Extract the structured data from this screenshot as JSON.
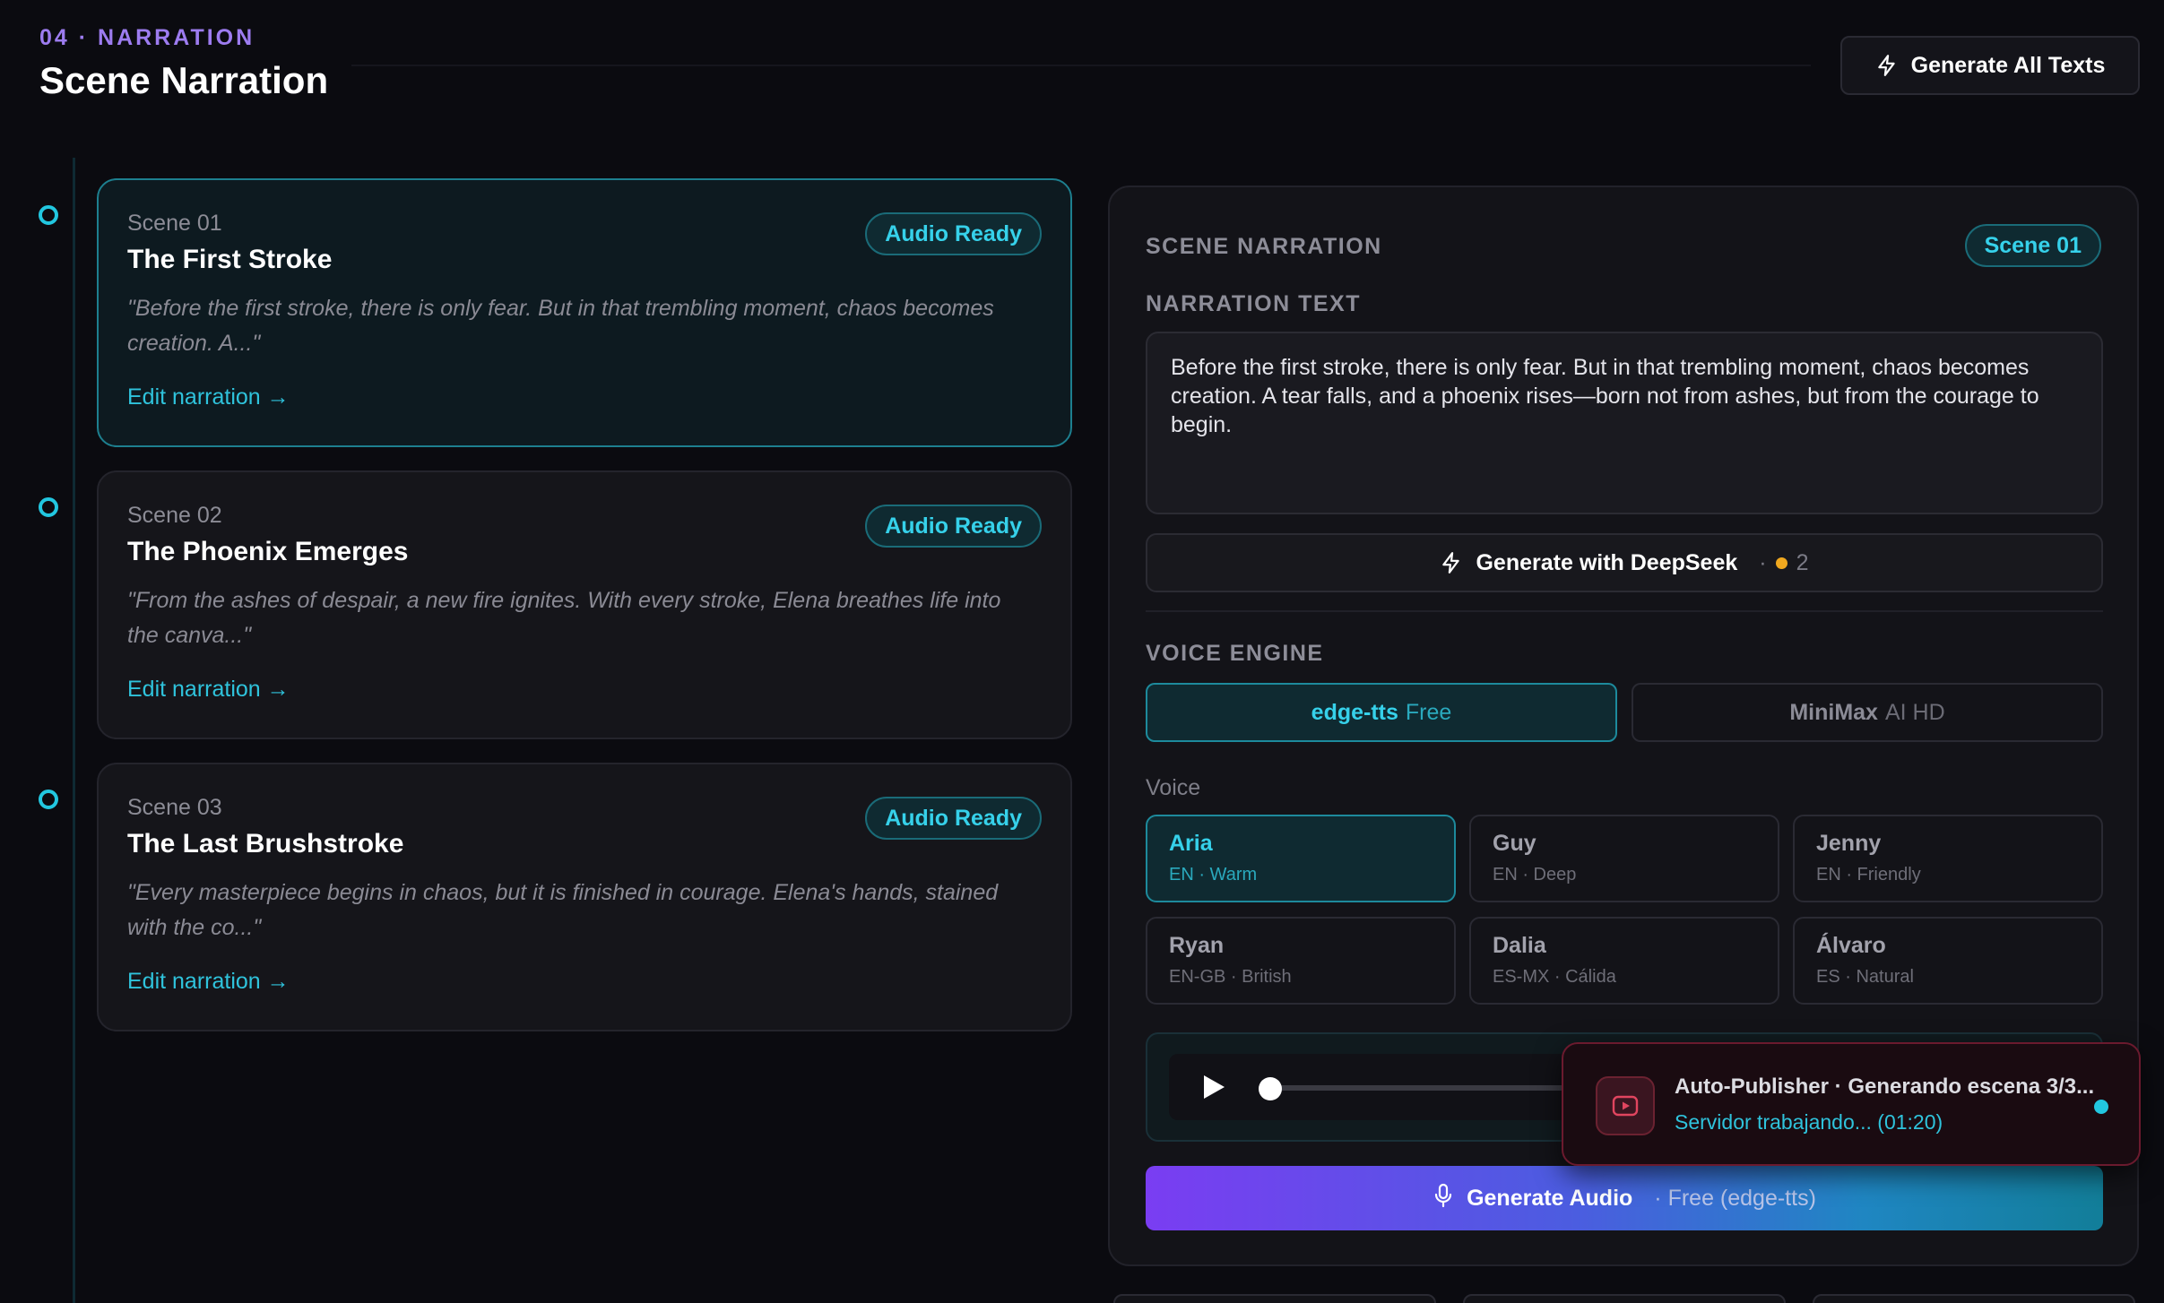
{
  "header": {
    "eyebrow": "04 · NARRATION",
    "title": "Scene Narration",
    "generate_all_label": "Generate All Texts"
  },
  "scenes": [
    {
      "number": "Scene 01",
      "title": "The First Stroke",
      "status": "Audio Ready",
      "excerpt": "\"Before the first stroke, there is only fear. But in that trembling moment, chaos becomes creation. A...\"",
      "edit_label": "Edit narration →"
    },
    {
      "number": "Scene 02",
      "title": "The Phoenix Emerges",
      "status": "Audio Ready",
      "excerpt": "\"From the ashes of despair, a new fire ignites. With every stroke, Elena breathes life into the canva...\"",
      "edit_label": "Edit narration →"
    },
    {
      "number": "Scene 03",
      "title": "The Last Brushstroke",
      "status": "Audio Ready",
      "excerpt": "\"Every masterpiece begins in chaos, but it is finished in courage. Elena's hands, stained with the co...\"",
      "edit_label": "Edit narration →"
    }
  ],
  "panel": {
    "section_label": "SCENE NARRATION",
    "scene_badge": "Scene 01",
    "narration_label": "NARRATION TEXT",
    "narration_text": "Before the first stroke, there is only fear. But in that trembling moment, chaos becomes creation. A tear falls, and a phoenix rises—born not from ashes, but from the courage to begin.",
    "deepseek_label": "Generate with DeepSeek",
    "deepseek_cost": "2",
    "voice_engine_label": "VOICE ENGINE",
    "engines": [
      {
        "name": "edge-tts",
        "tier": "Free",
        "selected": true
      },
      {
        "name": "MiniMax",
        "tier": "AI HD",
        "selected": false
      }
    ],
    "voice_label": "Voice",
    "voices": [
      {
        "name": "Aria",
        "meta": "EN · Warm",
        "selected": true
      },
      {
        "name": "Guy",
        "meta": "EN · Deep",
        "selected": false
      },
      {
        "name": "Jenny",
        "meta": "EN · Friendly",
        "selected": false
      },
      {
        "name": "Ryan",
        "meta": "EN-GB · British",
        "selected": false
      },
      {
        "name": "Dalia",
        "meta": "ES-MX · Cálida",
        "selected": false
      },
      {
        "name": "Álvaro",
        "meta": "ES · Natural",
        "selected": false
      }
    ],
    "player_progress": 0,
    "generate_audio_label": "Generate Audio",
    "generate_audio_sub": "· Free (edge-tts)"
  },
  "toast": {
    "title": "Auto-Publisher · Generando escena 3/3...",
    "status": "Servidor trabajando... (01:20)"
  },
  "colors": {
    "accent": "#22c7e0",
    "purple": "#9d7cf0",
    "background": "#0b0b10"
  }
}
